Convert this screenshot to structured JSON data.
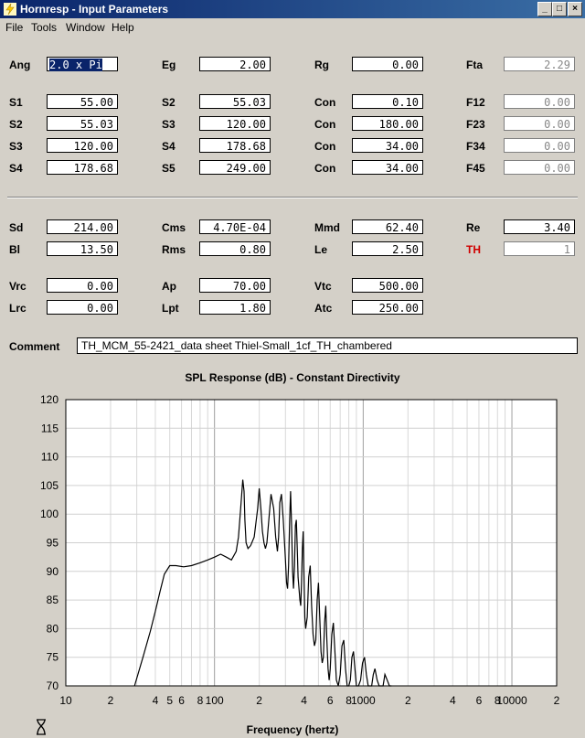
{
  "window": {
    "title": "Hornresp - Input Parameters",
    "min": "_",
    "max": "□",
    "close": "×"
  },
  "menu": [
    "File",
    "Tools",
    "Window",
    "Help"
  ],
  "params": {
    "ang": {
      "label": "Ang",
      "value": "2.0 x Pi"
    },
    "eg": {
      "label": "Eg",
      "value": "2.00"
    },
    "rg": {
      "label": "Rg",
      "value": "0.00"
    },
    "fta": {
      "label": "Fta",
      "value": "2.29"
    },
    "s1": {
      "label": "S1",
      "value": "55.00"
    },
    "s2b": {
      "label": "S2",
      "value": "55.03"
    },
    "con1": {
      "label": "Con",
      "value": "0.10"
    },
    "f12": {
      "label": "F12",
      "value": "0.00"
    },
    "s2": {
      "label": "S2",
      "value": "55.03"
    },
    "s3b": {
      "label": "S3",
      "value": "120.00"
    },
    "con2": {
      "label": "Con",
      "value": "180.00"
    },
    "f23": {
      "label": "F23",
      "value": "0.00"
    },
    "s3": {
      "label": "S3",
      "value": "120.00"
    },
    "s4b": {
      "label": "S4",
      "value": "178.68"
    },
    "con3": {
      "label": "Con",
      "value": "34.00"
    },
    "f34": {
      "label": "F34",
      "value": "0.00"
    },
    "s4": {
      "label": "S4",
      "value": "178.68"
    },
    "s5": {
      "label": "S5",
      "value": "249.00"
    },
    "con4": {
      "label": "Con",
      "value": "34.00"
    },
    "f45": {
      "label": "F45",
      "value": "0.00"
    },
    "sd": {
      "label": "Sd",
      "value": "214.00"
    },
    "cms": {
      "label": "Cms",
      "value": "4.70E-04"
    },
    "mmd": {
      "label": "Mmd",
      "value": "62.40"
    },
    "re": {
      "label": "Re",
      "value": "3.40"
    },
    "bl": {
      "label": "Bl",
      "value": "13.50"
    },
    "rms": {
      "label": "Rms",
      "value": "0.80"
    },
    "le": {
      "label": "Le",
      "value": "2.50"
    },
    "th": {
      "label": "TH",
      "value": "1"
    },
    "vrc": {
      "label": "Vrc",
      "value": "0.00"
    },
    "ap": {
      "label": "Ap",
      "value": "70.00"
    },
    "vtc": {
      "label": "Vtc",
      "value": "500.00"
    },
    "lrc": {
      "label": "Lrc",
      "value": "0.00"
    },
    "lpt": {
      "label": "Lpt",
      "value": "1.80"
    },
    "atc": {
      "label": "Atc",
      "value": "250.00"
    }
  },
  "comment": {
    "label": "Comment",
    "value": "TH_MCM_55-2421_data sheet Thiel-Small_1cf_TH_chambered"
  },
  "colors": {
    "accent": "#0a246a",
    "th_label": "#d00000",
    "curve": "#000000"
  },
  "chart_data": {
    "type": "line",
    "title": "SPL Response (dB) - Constant Directivity",
    "xlabel": "Frequency (hertz)",
    "ylabel": "",
    "xscale": "log",
    "xlim": [
      10,
      20000
    ],
    "ylim": [
      70,
      120
    ],
    "yticks": [
      70,
      75,
      80,
      85,
      90,
      95,
      100,
      105,
      110,
      115,
      120
    ],
    "xticks": [
      {
        "v": 10,
        "t": "10"
      },
      {
        "v": 20,
        "t": "2"
      },
      {
        "v": 40,
        "t": "4"
      },
      {
        "v": 50,
        "t": "5"
      },
      {
        "v": 60,
        "t": "6"
      },
      {
        "v": 80,
        "t": "8"
      },
      {
        "v": 100,
        "t": "100"
      },
      {
        "v": 200,
        "t": "2"
      },
      {
        "v": 400,
        "t": "4"
      },
      {
        "v": 600,
        "t": "6"
      },
      {
        "v": 800,
        "t": "8"
      },
      {
        "v": 1000,
        "t": "1000"
      },
      {
        "v": 2000,
        "t": "2"
      },
      {
        "v": 4000,
        "t": "4"
      },
      {
        "v": 6000,
        "t": "6"
      },
      {
        "v": 8000,
        "t": "8"
      },
      {
        "v": 10000,
        "t": "10000"
      },
      {
        "v": 20000,
        "t": "2"
      }
    ],
    "grid": true,
    "series": [
      {
        "name": "",
        "x": [
          29,
          33,
          37,
          40,
          43,
          46,
          50,
          55,
          62,
          70,
          80,
          90,
          100,
          110,
          120,
          130,
          140,
          145,
          150,
          155,
          158,
          160,
          163,
          168,
          175,
          185,
          195,
          200,
          205,
          210,
          215,
          220,
          225,
          232,
          240,
          250,
          258,
          265,
          270,
          275,
          282,
          290,
          300,
          305,
          310,
          315,
          320,
          325,
          330,
          335,
          340,
          345,
          350,
          355,
          360,
          365,
          370,
          375,
          380,
          385,
          390,
          395,
          400,
          405,
          410,
          420,
          430,
          440,
          450,
          460,
          470,
          480,
          490,
          500,
          510,
          520,
          530,
          540,
          550,
          560,
          570,
          580,
          590,
          600,
          615,
          630,
          645,
          660,
          680,
          700,
          720,
          740,
          760,
          780,
          800,
          820,
          840,
          860,
          880,
          900,
          930,
          960,
          990,
          1020,
          1050,
          1080,
          1110,
          1140,
          1170,
          1200,
          1240,
          1280,
          1320,
          1360,
          1400,
          1450,
          1500,
          1550
        ],
        "y": [
          70,
          75,
          79.5,
          83,
          86.5,
          89.5,
          91,
          91,
          90.8,
          91,
          91.5,
          92,
          92.5,
          93,
          92.5,
          92,
          93.5,
          96,
          101,
          106,
          104,
          99,
          95,
          94,
          94.5,
          96,
          101,
          104.5,
          101,
          97,
          95,
          94,
          95,
          99,
          103.5,
          101,
          96,
          93.5,
          96,
          102,
          103.5,
          99,
          92,
          88,
          87,
          91,
          99,
          104,
          98,
          90,
          87,
          91,
          98,
          99,
          94,
          89,
          87,
          85,
          84,
          88,
          94,
          97,
          89,
          82,
          80,
          82,
          89,
          91,
          84,
          79,
          77,
          78,
          85,
          88,
          82,
          76,
          74,
          75,
          81,
          84,
          78,
          73,
          71,
          73,
          79,
          81,
          76,
          71,
          70,
          72,
          77,
          78,
          73,
          70,
          70,
          71,
          75,
          76,
          73,
          70,
          70,
          71,
          74,
          75,
          72,
          70,
          70,
          70,
          72,
          73,
          71,
          70,
          70,
          70,
          72,
          71,
          70,
          70
        ]
      }
    ]
  }
}
